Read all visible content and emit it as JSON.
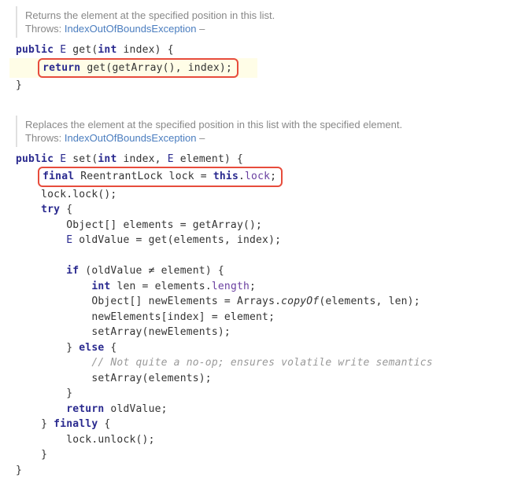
{
  "doc1": {
    "desc": "Returns the element at the specified position in this list.",
    "throws_label": "Throws:",
    "throws_link": "IndexOutOfBoundsException",
    "throws_dash": "–"
  },
  "code1": {
    "sig_public": "public",
    "sig_ret": "E",
    "sig_name": "get",
    "sig_params_open": "(",
    "sig_param_type": "int",
    "sig_param_name": "index",
    "sig_params_close": ")",
    "sig_brace": "{",
    "ret_kw": "return",
    "ret_call1": "get",
    "ret_call2": "getArray",
    "ret_paren1": "(",
    "ret_paren2": "()",
    "ret_comma": ", ",
    "ret_arg": "index",
    "ret_close": ");",
    "close_brace": "}"
  },
  "doc2": {
    "desc": "Replaces the element at the specified position in this list with the specified element.",
    "throws_label": "Throws:",
    "throws_link": "IndexOutOfBoundsException",
    "throws_dash": "–"
  },
  "code2": {
    "sig_public": "public",
    "sig_ret": "E",
    "sig_name": "set",
    "sig_po": "(",
    "sig_p1t": "int",
    "sig_p1n": "index",
    "sig_c": ", ",
    "sig_p2t": "E",
    "sig_p2n": "element",
    "sig_pc": ")",
    "sig_brace": "{",
    "l1_final": "final",
    "l1_type": "ReentrantLock",
    "l1_var": "lock",
    "l1_eq": " = ",
    "l1_this": "this",
    "l1_dot": ".",
    "l1_field": "lock",
    "l1_semi": ";",
    "l2": "lock.lock();",
    "l3_try": "try",
    "l3_brace": " {",
    "l4_type": "Object[]",
    "l4_var": " elements = getArray();",
    "l5_type": "E",
    "l5_rest": " oldValue = get(elements, index);",
    "l7_if": "if",
    "l7_rest": " (oldValue ≠ element) {",
    "l8_int": "int",
    "l8_rest": " len = elements.",
    "l8_field": "length",
    "l8_semi": ";",
    "l9_type": "Object[]",
    "l9_rest": " newElements = Arrays.",
    "l9_copy": "copyOf",
    "l9_args": "(elements, len);",
    "l10": "newElements[index] = element;",
    "l11": "setArray(newElements);",
    "l12_else": "} ",
    "l12_kw": "else",
    "l12_brace": " {",
    "l13_comment": "// Not quite a no-op; ensures volatile write semantics",
    "l14": "setArray(elements);",
    "l15": "}",
    "l16_ret": "return",
    "l16_rest": " oldValue;",
    "l17_brace": "} ",
    "l17_fin": "finally",
    "l17_brace2": " {",
    "l18": "lock.unlock();",
    "l19": "}",
    "l20": "}"
  }
}
